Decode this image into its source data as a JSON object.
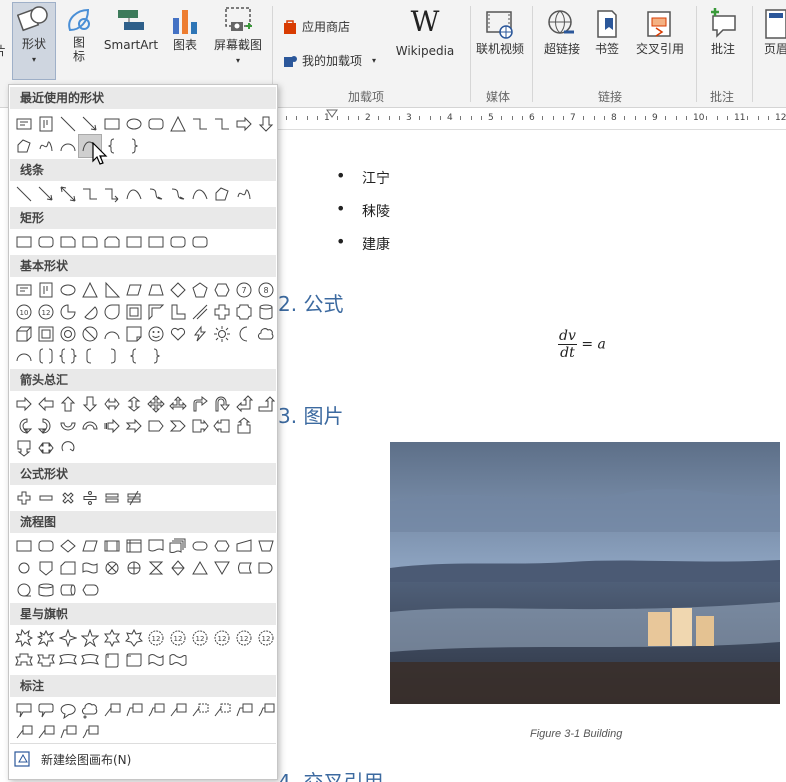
{
  "ribbon": {
    "partial_left_label": "片",
    "shapes_label": "形状",
    "icons_label": "图标",
    "smartart_label": "SmartArt",
    "chart_label": "图表",
    "screenshot_label": "屏幕截图",
    "app_store_label": "应用商店",
    "my_addins_label": "我的加载项",
    "wikipedia_label": "Wikipedia",
    "addins_group": "加载项",
    "online_video_label": "联机视频",
    "media_group": "媒体",
    "hyperlink_label": "超链接",
    "bookmark_label": "书签",
    "crossref_label": "交叉引用",
    "links_group": "链接",
    "comment_label": "批注",
    "comments_group": "批注",
    "header_label": "页眉"
  },
  "ruler": {
    "numbers": [
      "1",
      "2",
      "3",
      "4",
      "5",
      "6",
      "7",
      "8",
      "9",
      "10",
      "11",
      "12"
    ]
  },
  "document": {
    "bullets": [
      "江宁",
      "秣陵",
      "建康"
    ],
    "heading2": "2. 公式",
    "formula_num": "dv",
    "formula_den": "dt",
    "formula_rhs": "= a",
    "heading3": "3. 图片",
    "caption": "Figure 3-1 Building",
    "heading4": "4. 交叉引用"
  },
  "shapes_panel": {
    "categories": [
      "最近使用的形状",
      "线条",
      "矩形",
      "基本形状",
      "箭头总汇",
      "公式形状",
      "流程图",
      "星与旗帜",
      "标注"
    ],
    "new_canvas": "新建绘图画布(N)"
  },
  "colors": {
    "accent": "#3c6aa0",
    "ribbon_bg": "#f3f3f3"
  }
}
